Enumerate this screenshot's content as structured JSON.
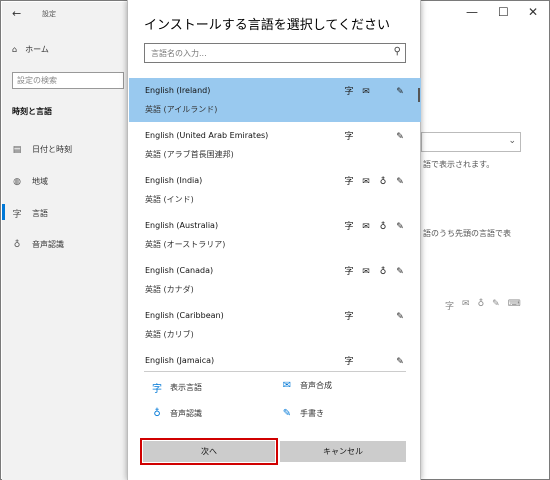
{
  "settings_window": {
    "title": "設定",
    "home_label": "ホーム",
    "search_placeholder": "設定の検索",
    "section_heading": "時刻と言語",
    "nav_items": [
      {
        "label": "日付と時刻",
        "icon": "calendar-clock-icon"
      },
      {
        "label": "地域",
        "icon": "globe-icon"
      },
      {
        "label": "言語",
        "icon": "language-icon"
      },
      {
        "label": "音声認識",
        "icon": "microphone-icon"
      }
    ],
    "right_fragments": {
      "line1": "語で表示されます。",
      "line2": "語のうち先頭の言語で表"
    }
  },
  "dialog": {
    "title": "インストールする言語を選択してください",
    "search_placeholder": "言語名の入力...",
    "languages": [
      {
        "name": "English (Ireland)",
        "native": "英語 (アイルランド)",
        "selected": true,
        "features": {
          "display": true,
          "tts": true,
          "speech": false,
          "handwriting": true
        }
      },
      {
        "name": "English (United Arab Emirates)",
        "native": "英語 (アラブ首長国連邦)",
        "selected": false,
        "features": {
          "display": true,
          "tts": false,
          "speech": false,
          "handwriting": true
        }
      },
      {
        "name": "English (India)",
        "native": "英語 (インド)",
        "selected": false,
        "features": {
          "display": true,
          "tts": true,
          "speech": true,
          "handwriting": true
        }
      },
      {
        "name": "English (Australia)",
        "native": "英語 (オーストラリア)",
        "selected": false,
        "features": {
          "display": true,
          "tts": true,
          "speech": true,
          "handwriting": true
        }
      },
      {
        "name": "English (Canada)",
        "native": "英語 (カナダ)",
        "selected": false,
        "features": {
          "display": true,
          "tts": true,
          "speech": true,
          "handwriting": true
        }
      },
      {
        "name": "English (Caribbean)",
        "native": "英語 (カリブ)",
        "selected": false,
        "features": {
          "display": true,
          "tts": false,
          "speech": false,
          "handwriting": true
        }
      },
      {
        "name": "English (Jamaica)",
        "native": "",
        "selected": false,
        "features": {
          "display": true,
          "tts": false,
          "speech": false,
          "handwriting": true
        }
      }
    ],
    "legend": {
      "display": "表示言語",
      "tts": "音声合成",
      "speech": "音声認識",
      "handwriting": "手書き"
    },
    "next_label": "次へ",
    "cancel_label": "キャンセル"
  },
  "colors": {
    "selected_row": "#99c9ef",
    "accent": "#0078d7",
    "highlight_border": "#d00000"
  }
}
